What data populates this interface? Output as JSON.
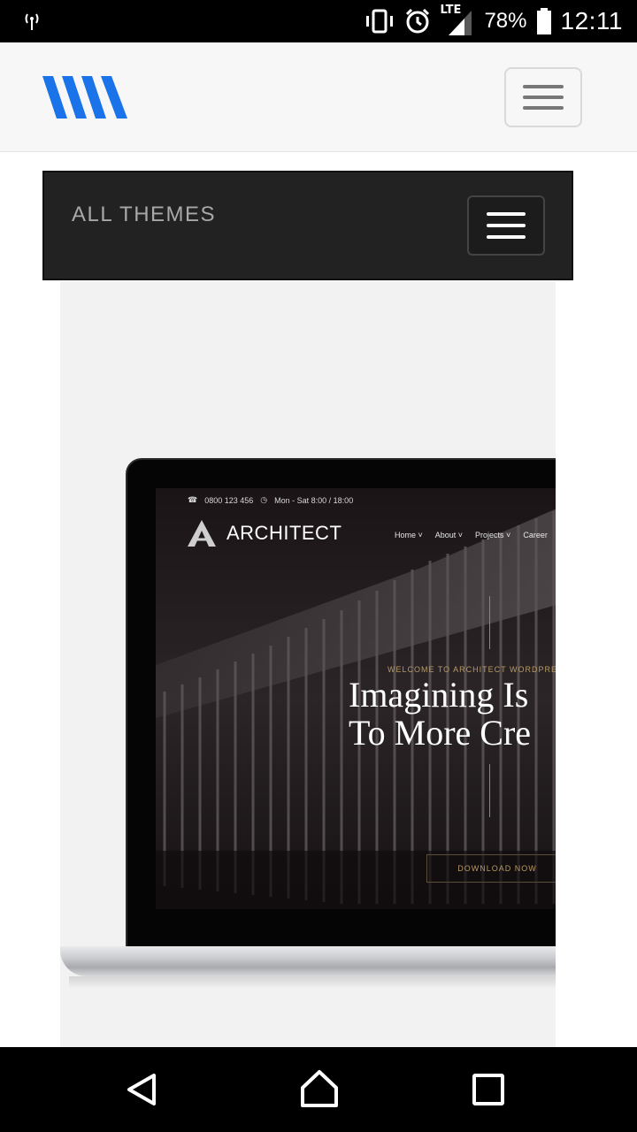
{
  "status_bar": {
    "battery": "78%",
    "time": "12:11",
    "network": "LTE",
    "icons": [
      "signal-tower-icon",
      "vibrate-icon",
      "alarm-icon",
      "lte-signal-icon",
      "battery-icon"
    ]
  },
  "header": {
    "logo_icon": "wm-logo-icon",
    "menu_icon": "hamburger-icon",
    "accent": "#1a73e8"
  },
  "themes_bar": {
    "title": "ALL THEMES",
    "menu_icon": "hamburger-icon"
  },
  "preview": {
    "phone": "0800 123 456",
    "hours": "Mon - Sat 8:00 / 18:00",
    "brand": "ARCHITECT",
    "nav": [
      "Home",
      "About",
      "Projects",
      "Career"
    ],
    "welcome": "WELCOME TO ARCHITECT WORDPRESS",
    "headline_1": "Imagining Is",
    "headline_2": "To More Cre",
    "cta": "DOWNLOAD NOW",
    "gold": "#b89966"
  },
  "nav_bar": {
    "icons": [
      "back-icon",
      "home-icon",
      "recent-apps-icon"
    ]
  }
}
